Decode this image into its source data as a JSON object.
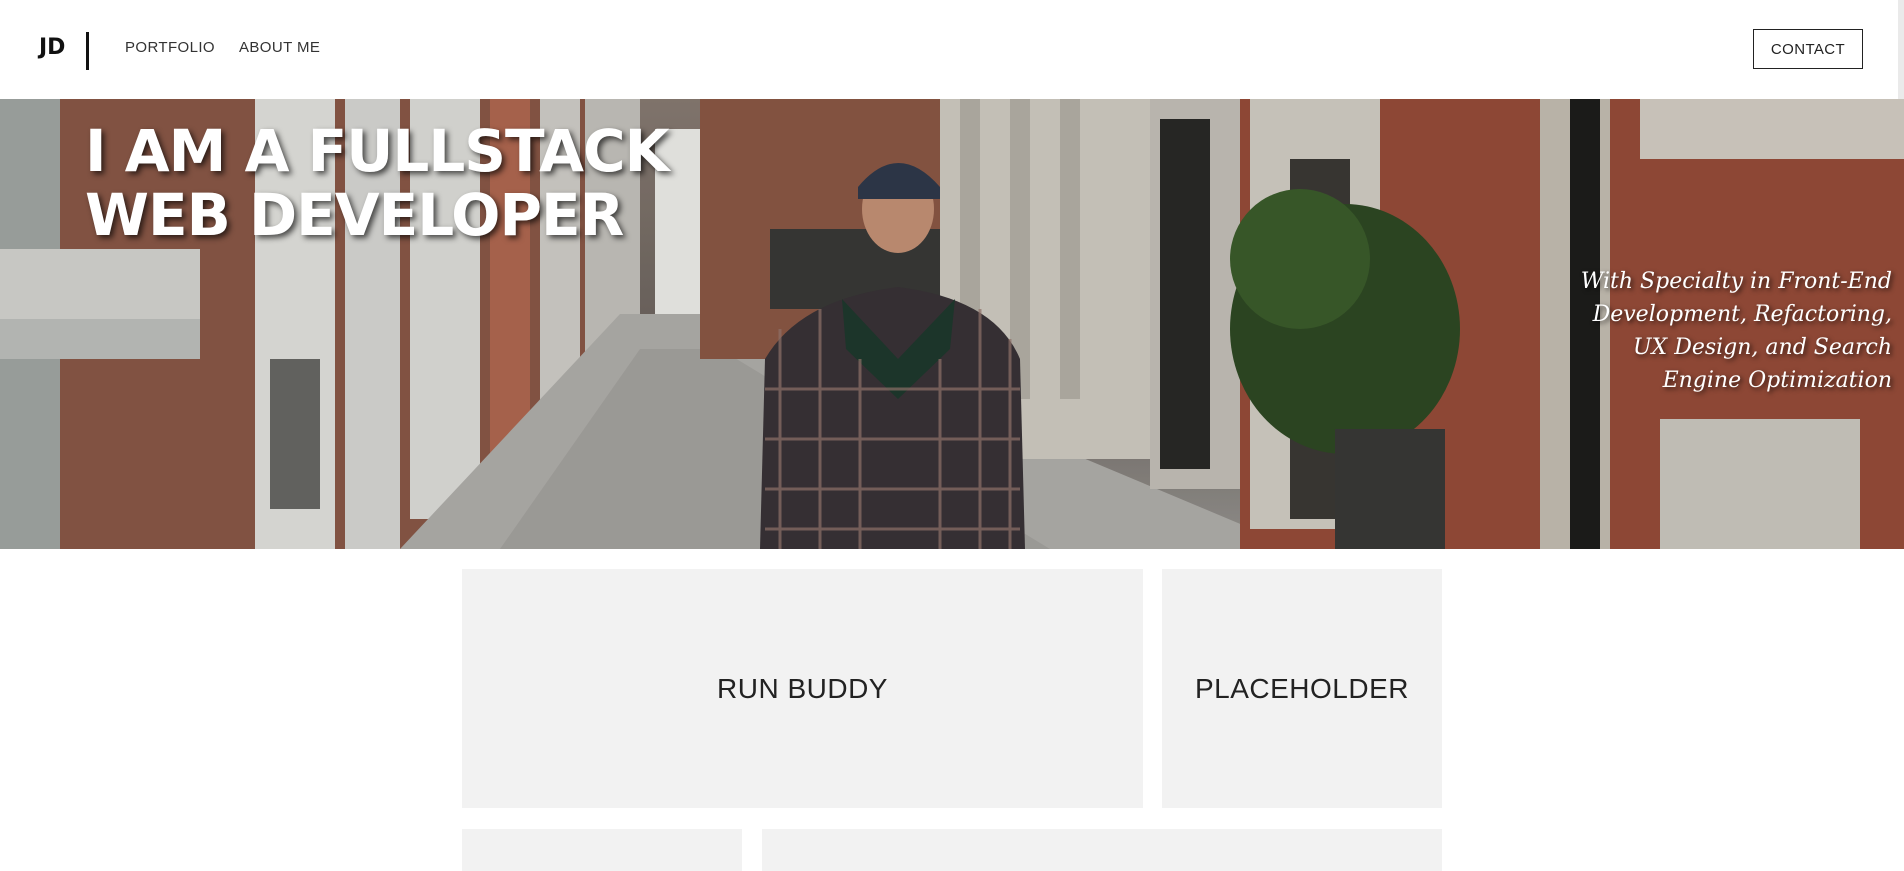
{
  "header": {
    "logo": "JD",
    "nav": [
      "PORTFOLIO",
      "ABOUT ME"
    ],
    "contact_label": "CONTACT"
  },
  "hero": {
    "title_line1": "I AM A FULLSTACK",
    "title_line2": "WEB DEVELOPER",
    "subtitle_lines": [
      "With Specialty in Front-End",
      "Development, Refactoring,",
      "UX Design, and Search",
      "Engine Optimization"
    ]
  },
  "portfolio": {
    "cards": [
      "RUN BUDDY",
      "PLACEHOLDER",
      "",
      ""
    ]
  }
}
